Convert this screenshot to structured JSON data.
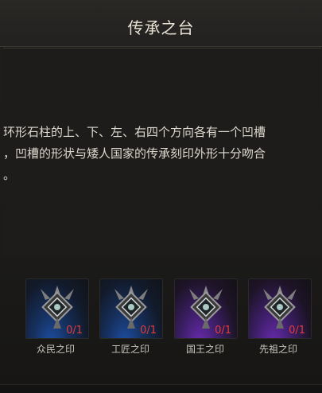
{
  "dialog": {
    "title": "传承之台",
    "description_lines": [
      "环形石柱的上、下、左、右四个方向各有一个凹槽",
      "，凹槽的形状与矮人国家的传承刻印外形十分吻合",
      "。"
    ]
  },
  "slots": [
    {
      "label": "众民之印",
      "count": "0/1",
      "rarity_color": "#1d4fa4",
      "icon": "seal-icon"
    },
    {
      "label": "工匠之印",
      "count": "0/1",
      "rarity_color": "#1d4fa4",
      "icon": "seal-icon"
    },
    {
      "label": "国王之印",
      "count": "0/1",
      "rarity_color": "#6b2bb0",
      "icon": "seal-icon"
    },
    {
      "label": "先祖之印",
      "count": "0/1",
      "rarity_color": "#6b2bb0",
      "icon": "seal-icon"
    }
  ]
}
